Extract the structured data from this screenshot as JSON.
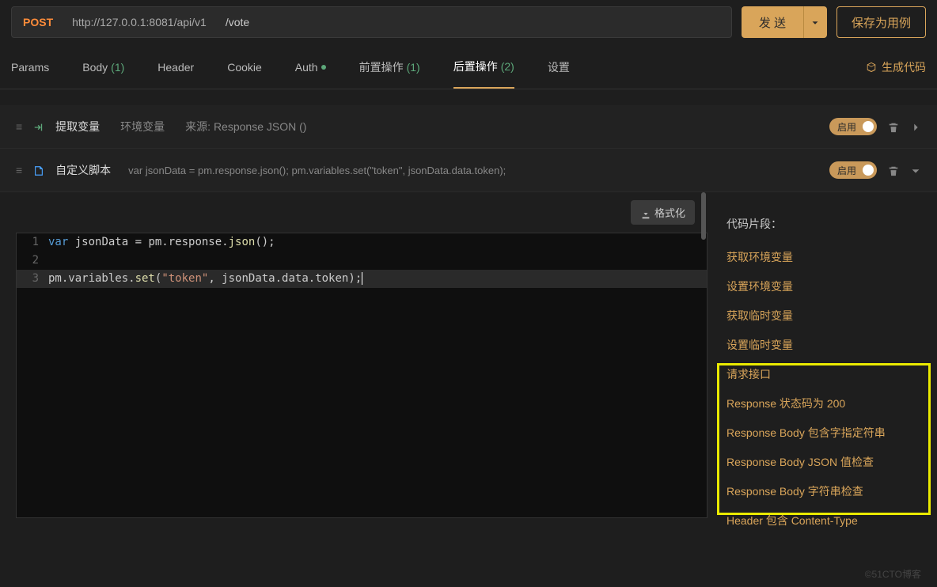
{
  "request": {
    "method": "POST",
    "base_url": "http://127.0.0.1:8081/api/v1",
    "path": "/vote",
    "send_label": "发 送",
    "save_label": "保存为用例"
  },
  "tabs": {
    "params": "Params",
    "body": "Body",
    "body_count": "(1)",
    "header": "Header",
    "cookie": "Cookie",
    "auth": "Auth",
    "pre": "前置操作",
    "pre_count": "(1)",
    "post": "后置操作",
    "post_count": "(2)",
    "settings": "设置",
    "gen_code": "生成代码"
  },
  "steps": {
    "extract": {
      "title": "提取变量",
      "kind": "环境变量",
      "source": "来源: Response JSON ()"
    },
    "script": {
      "title": "自定义脚本",
      "preview": "var jsonData = pm.response.json(); pm.variables.set(\"token\", jsonData.data.token);"
    },
    "toggle_label": "启用"
  },
  "editor": {
    "format_btn": "格式化",
    "lines": {
      "l1_kw": "var",
      "l1_rest": " jsonData = pm.response.",
      "l1_fn": "json",
      "l1_tail": "();",
      "l3_head": "pm.variables.",
      "l3_fn": "set",
      "l3_open": "(",
      "l3_str": "\"token\"",
      "l3_mid": ", jsonData.data.token);"
    }
  },
  "snippets": {
    "title": "代码片段：",
    "items": [
      "获取环境变量",
      "设置环境变量",
      "获取临时变量",
      "设置临时变量",
      "请求接口",
      "Response 状态码为 200",
      "Response Body 包含字指定符串",
      "Response Body JSON 值检查",
      "Response Body 字符串检查",
      "Header 包含 Content-Type"
    ]
  },
  "watermark": "©51CTO博客"
}
